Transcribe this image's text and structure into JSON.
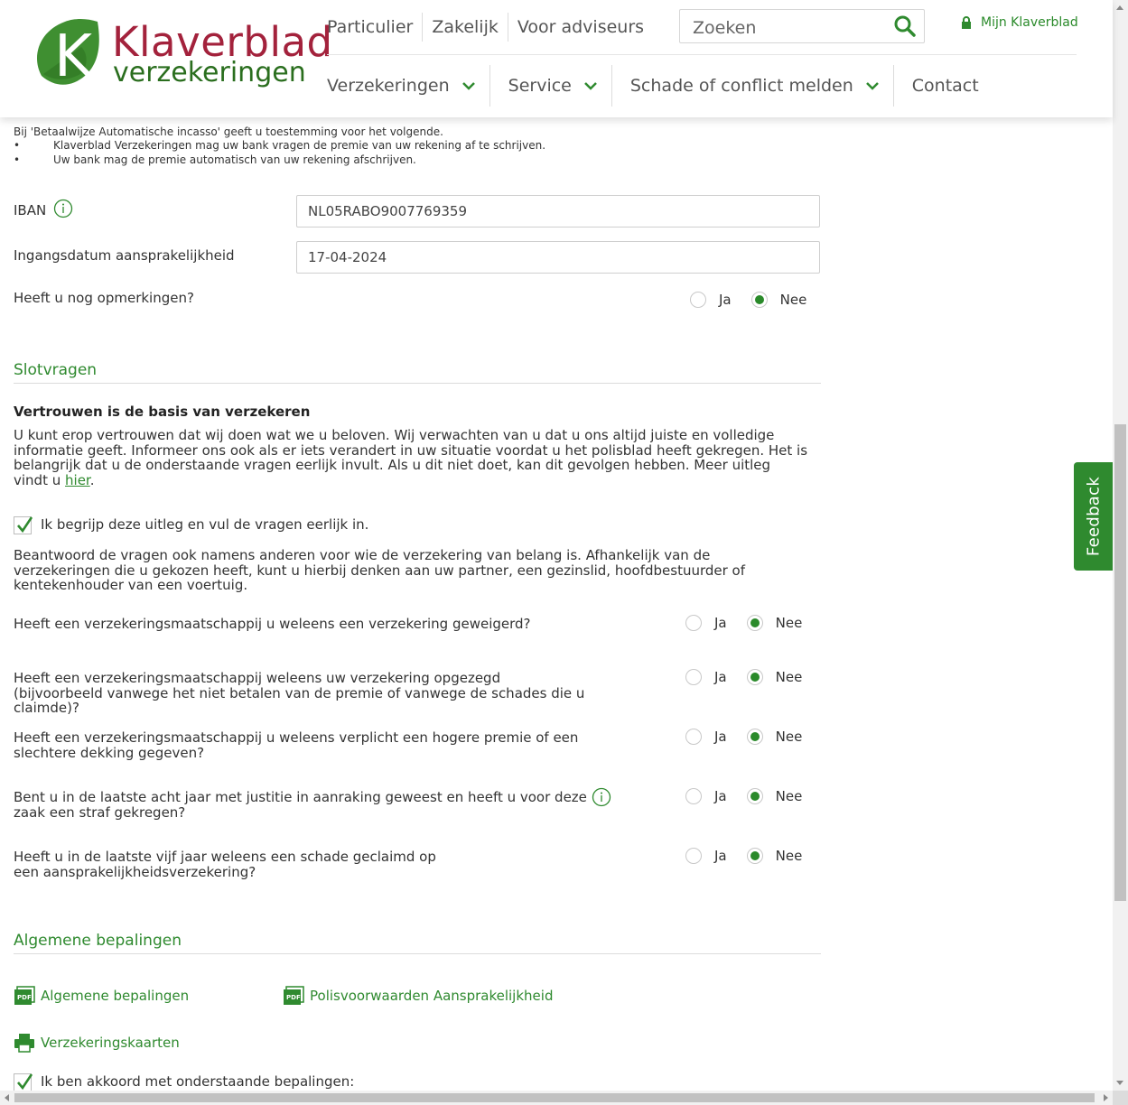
{
  "brand": {
    "name_line1": "Klaverblad",
    "name_line2": "verzekeringen",
    "colors": {
      "primary_green": "#2f8a2f",
      "brand_red": "#a3223c",
      "text": "#333333"
    }
  },
  "header": {
    "topnav": [
      "Particulier",
      "Zakelijk",
      "Voor adviseurs"
    ],
    "search_placeholder": "Zoeken",
    "account_link": "Mijn Klaverblad",
    "mainnav": [
      "Verzekeringen",
      "Service",
      "Schade of conflict melden",
      "Contact"
    ]
  },
  "incasso": {
    "intro": "Bij 'Betaalwijze Automatische incasso' geeft u toestemming voor het volgende.",
    "bullets": [
      "Klaverblad Verzekeringen mag uw bank vragen de premie van uw rekening af te schrijven.",
      "Uw bank mag de premie automatisch van uw rekening afschrijven."
    ],
    "bullet_char": "•"
  },
  "form": {
    "iban_label": "IBAN",
    "iban_value": "NL05RABO9007769359",
    "date_label": "Ingangsdatum aansprakelijkheid",
    "date_value": "17-04-2024",
    "remarks_label": "Heeft u nog opmerkingen?",
    "yes": "Ja",
    "no": "Nee",
    "remarks_answer": "Nee"
  },
  "slotvragen": {
    "title": "Slotvragen",
    "heading": "Vertrouwen is de basis van verzekeren",
    "intro": "U kunt erop vertrouwen dat wij doen wat we u beloven. Wij verwachten van u dat u ons altijd juiste en volledige informatie geeft. Informeer ons ook als er iets verandert in uw situatie voordat u het polisblad heeft gekregen. Het is belangrijk dat u de onderstaande vragen eerlijk invult. Als u dit niet doet, kan dit gevolgen hebben. Meer uitleg vindt u",
    "link": "hier",
    "link_suffix": ".",
    "confirm_label": "Ik begrijp deze uitleg en vul de vragen eerlijk in.",
    "confirm_checked": true,
    "answer_note": "Beantwoord de vragen ook namens anderen voor wie de verzekering van belang is. Afhankelijk van de verzekeringen die u gekozen heeft, kunt u hierbij denken aan uw partner, een gezinslid, hoofdbestuurder of kentekenhouder van een voertuig.",
    "questions": [
      {
        "text": "Heeft een verzekeringsmaatschappij u weleens een verzekering geweigerd?",
        "answer": "Nee"
      },
      {
        "text": "Heeft een verzekeringsmaatschappij weleens uw verzekering opgezegd (bijvoorbeeld vanwege het niet betalen van de premie of vanwege de schades die u claimde)?",
        "answer": "Nee"
      },
      {
        "text": "Heeft een verzekeringsmaatschappij u weleens verplicht een hogere premie of een slechtere dekking gegeven?",
        "answer": "Nee"
      },
      {
        "text": "Bent u in de laatste acht jaar met justitie in aanraking geweest en heeft u voor deze zaak een straf gekregen?",
        "answer": "Nee"
      },
      {
        "text": "Heeft u in de laatste vijf jaar weleens een schade geclaimd op een aansprakelijkheidsverzekering?",
        "answer": "Nee"
      }
    ]
  },
  "bepalingen": {
    "title": "Algemene bepalingen",
    "links": [
      "Algemene bepalingen",
      "Polisvoorwaarden Aansprakelijkheid"
    ],
    "print_link": "Verzekeringskaarten",
    "pdf_badge": "PDF",
    "agree_label": "Ik ben akkoord met onderstaande bepalingen:",
    "agree_checked": true
  },
  "feedback_tab": "Feedback",
  "icons": [
    "search-icon",
    "lock-icon",
    "chevron-down-icon",
    "info-icon",
    "pdf-icon",
    "printer-icon",
    "checkmark-icon"
  ]
}
